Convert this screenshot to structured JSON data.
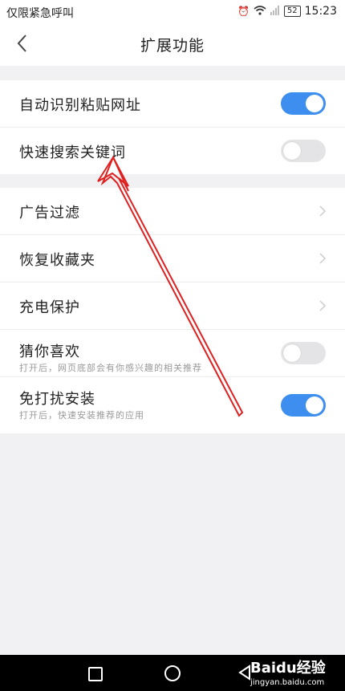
{
  "status_bar": {
    "carrier": "仅限紧急呼叫",
    "battery": "52",
    "time": "15:23"
  },
  "header": {
    "title": "扩展功能"
  },
  "group1": [
    {
      "label": "自动识别粘贴网址",
      "toggle": "on"
    },
    {
      "label": "快速搜索关键词",
      "toggle": "off"
    }
  ],
  "group2": [
    {
      "label": "广告过滤"
    },
    {
      "label": "恢复收藏夹"
    },
    {
      "label": "充电保护"
    },
    {
      "label": "猜你喜欢",
      "sub": "打开后，网页底部会有你感兴趣的相关推荐",
      "toggle": "off"
    },
    {
      "label": "免打扰安装",
      "sub": "打开后，快速安装推荐的应用",
      "toggle": "on"
    }
  ],
  "watermark": {
    "brand": "Baidu经验",
    "url": "jingyan.baidu.com"
  },
  "colors": {
    "accent": "#3e8ef0",
    "annotation": "#e02020"
  }
}
